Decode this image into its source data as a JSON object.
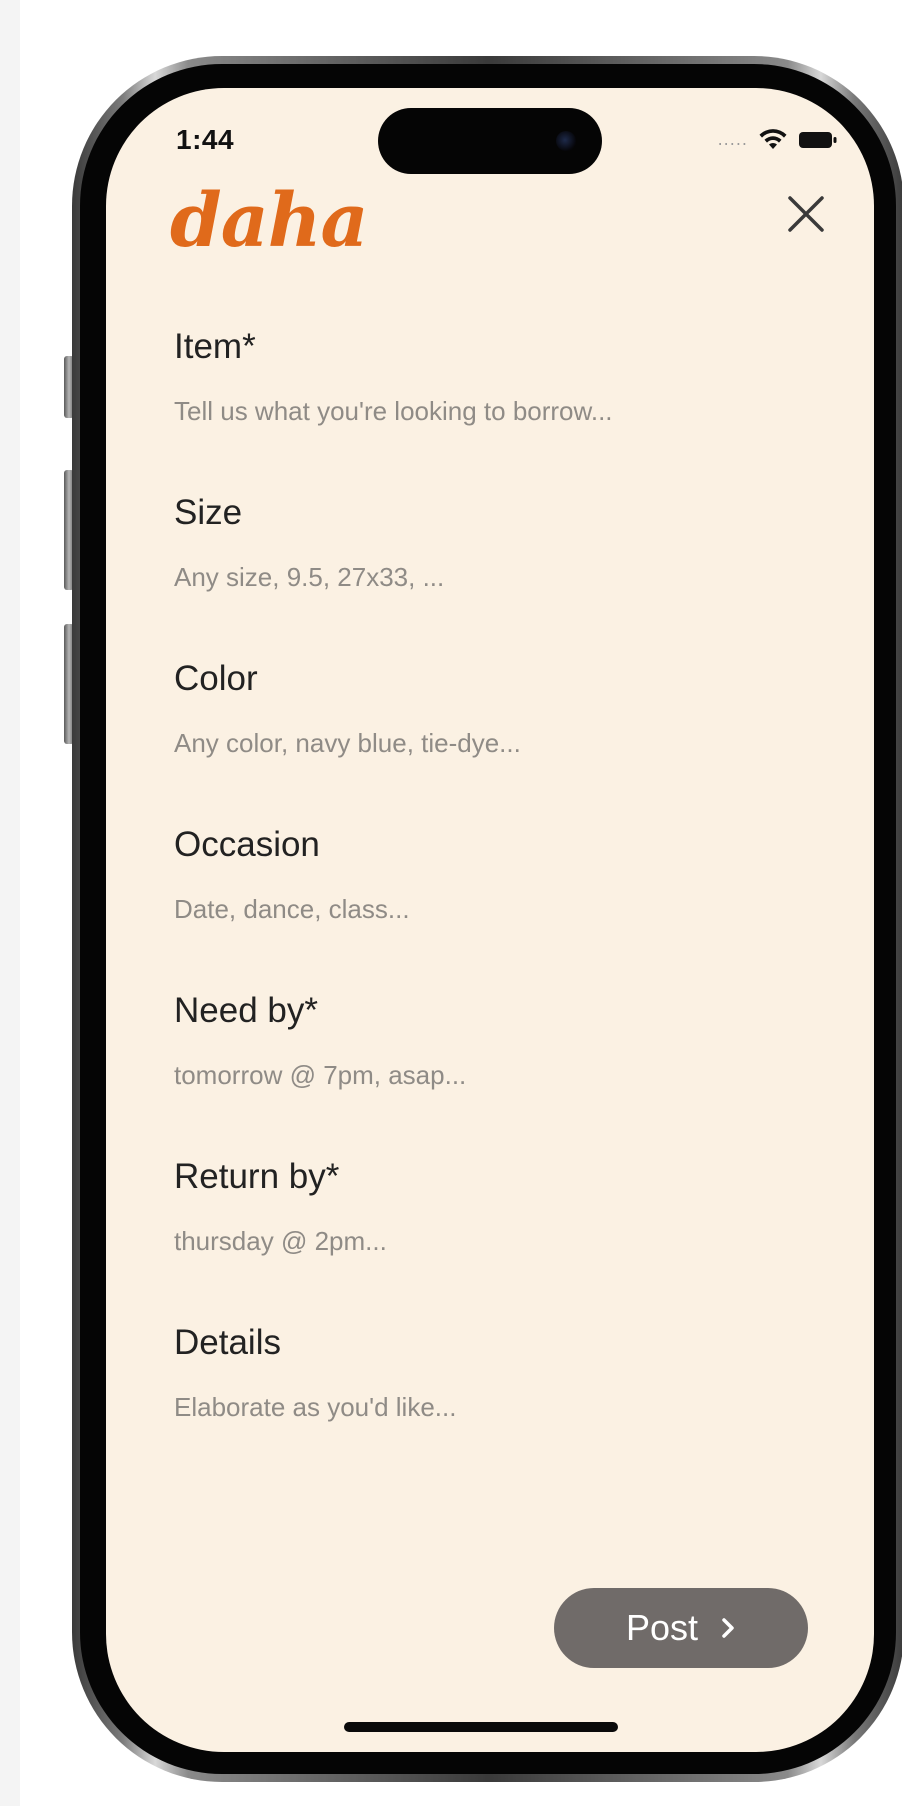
{
  "status_bar": {
    "time": "1:44",
    "signal_dots": "....."
  },
  "header": {
    "brand": "daha",
    "close_icon": "close-icon"
  },
  "form": {
    "fields": [
      {
        "label": "Item*",
        "placeholder": "Tell us what you're looking to borrow..."
      },
      {
        "label": "Size",
        "placeholder": "Any size, 9.5, 27x33, ..."
      },
      {
        "label": "Color",
        "placeholder": "Any color, navy blue, tie-dye..."
      },
      {
        "label": "Occasion",
        "placeholder": "Date, dance, class..."
      },
      {
        "label": "Need by*",
        "placeholder": "tomorrow @ 7pm, asap..."
      },
      {
        "label": "Return by*",
        "placeholder": "thursday @ 2pm..."
      },
      {
        "label": "Details",
        "placeholder": "Elaborate as you'd like..."
      }
    ]
  },
  "actions": {
    "post_label": "Post",
    "post_icon": "chevron-right-icon"
  },
  "colors": {
    "brand": "#e06a1b",
    "screen_bg": "#fbf1e3",
    "button_bg": "#706b69",
    "label_text": "#222222",
    "placeholder_text": "#8f8b86"
  }
}
